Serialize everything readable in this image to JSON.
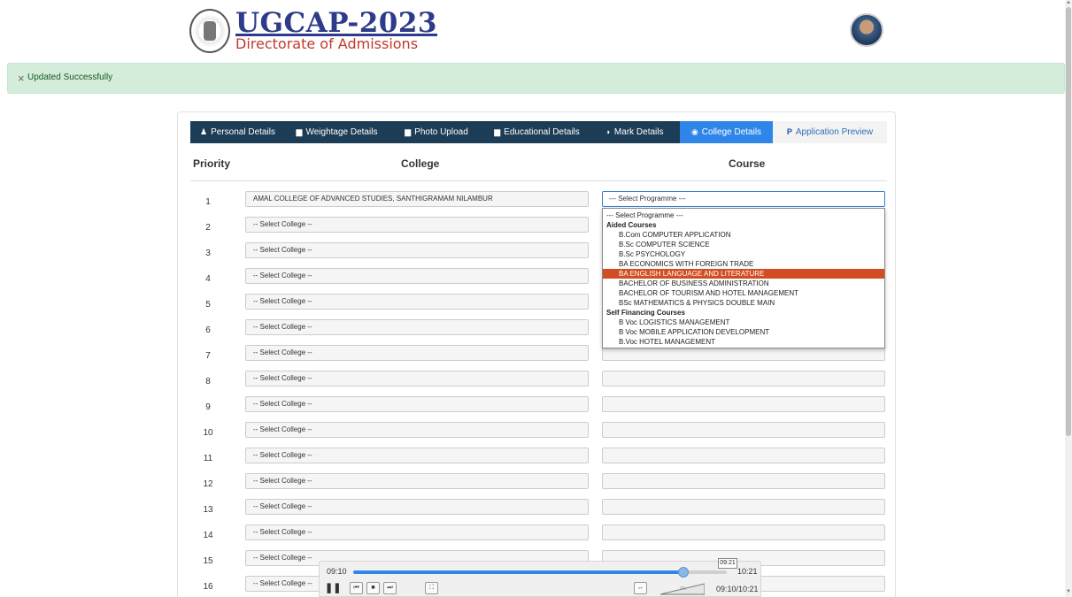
{
  "header": {
    "brand_title": "UGCAP-2023",
    "brand_subtitle": "Directorate of Admissions"
  },
  "alert": {
    "close_symbol": "×",
    "message": "Updated Successfully"
  },
  "tabs": [
    {
      "label": "Personal Details",
      "icon": "user-icon",
      "glyph": "♟"
    },
    {
      "label": "Weightage Details",
      "icon": "book-icon",
      "glyph": "▆"
    },
    {
      "label": "Photo Upload",
      "icon": "book-icon",
      "glyph": "▆"
    },
    {
      "label": "Educational Details",
      "icon": "book-icon",
      "glyph": "▆"
    },
    {
      "label": "Mark Details",
      "icon": "binoculars-icon",
      "glyph": "◗"
    },
    {
      "label": "College Details",
      "icon": "radio-icon",
      "glyph": "◉"
    },
    {
      "label": "Application Preview",
      "icon": "paypal-icon",
      "glyph": "P"
    }
  ],
  "table": {
    "headers": {
      "priority": "Priority",
      "college": "College",
      "course": "Course"
    },
    "rows": [
      {
        "priority": "1",
        "college": "AMAL COLLEGE OF ADVANCED STUDIES, SANTHIGRAMAM NILAMBUR",
        "course": "--- Select Programme ---"
      },
      {
        "priority": "2",
        "college": "-- Select College --",
        "course": ""
      },
      {
        "priority": "3",
        "college": "-- Select College --",
        "course": ""
      },
      {
        "priority": "4",
        "college": "-- Select College --",
        "course": ""
      },
      {
        "priority": "5",
        "college": "-- Select College --",
        "course": ""
      },
      {
        "priority": "6",
        "college": "-- Select College --",
        "course": ""
      },
      {
        "priority": "7",
        "college": "-- Select College --",
        "course": ""
      },
      {
        "priority": "8",
        "college": "-- Select College --",
        "course": ""
      },
      {
        "priority": "9",
        "college": "-- Select College --",
        "course": ""
      },
      {
        "priority": "10",
        "college": "-- Select College --",
        "course": ""
      },
      {
        "priority": "11",
        "college": "-- Select College --",
        "course": ""
      },
      {
        "priority": "12",
        "college": "-- Select College --",
        "course": ""
      },
      {
        "priority": "13",
        "college": "-- Select College --",
        "course": ""
      },
      {
        "priority": "14",
        "college": "-- Select College --",
        "course": ""
      },
      {
        "priority": "15",
        "college": "-- Select College --",
        "course": ""
      },
      {
        "priority": "16",
        "college": "-- Select College --",
        "course": ""
      }
    ]
  },
  "course_dropdown": {
    "options": [
      {
        "label": "--- Select Programme ---",
        "kind": "option"
      },
      {
        "label": "Aided Courses",
        "kind": "group"
      },
      {
        "label": "B.Com COMPUTER APPLICATION",
        "kind": "child"
      },
      {
        "label": "B.Sc COMPUTER SCIENCE",
        "kind": "child"
      },
      {
        "label": "B.Sc PSYCHOLOGY",
        "kind": "child"
      },
      {
        "label": "BA ECONOMICS WITH FOREIGN TRADE",
        "kind": "child"
      },
      {
        "label": "BA ENGLISH LANGUAGE AND LITERATURE",
        "kind": "child",
        "highlighted": true
      },
      {
        "label": "BACHELOR OF BUSINESS ADMINISTRATION",
        "kind": "child"
      },
      {
        "label": "BACHELOR OF TOURISM AND HOTEL MANAGEMENT",
        "kind": "child"
      },
      {
        "label": "BSc MATHEMATICS & PHYSICS DOUBLE MAIN",
        "kind": "child"
      },
      {
        "label": "Self Financing Courses",
        "kind": "group"
      },
      {
        "label": "B Voc LOGISTICS MANAGEMENT",
        "kind": "child"
      },
      {
        "label": "B Voc MOBILE APPLICATION DEVELOPMENT",
        "kind": "child"
      },
      {
        "label": "B.Voc HOTEL MANAGEMENT",
        "kind": "child"
      }
    ]
  },
  "player": {
    "current_time": "09:10",
    "total_time": "10:21",
    "hover_time": "09:21",
    "readout": "09:10/10:21",
    "progress_fraction": 0.883,
    "volume_label": "0%",
    "accent_color": "#2f86e8"
  },
  "colors": {
    "tab_dark": "#1d3c55",
    "tab_active": "#2f86e8",
    "alert_bg": "#d4edda",
    "highlight": "#d24d22",
    "brand": "#2d3b8a"
  }
}
